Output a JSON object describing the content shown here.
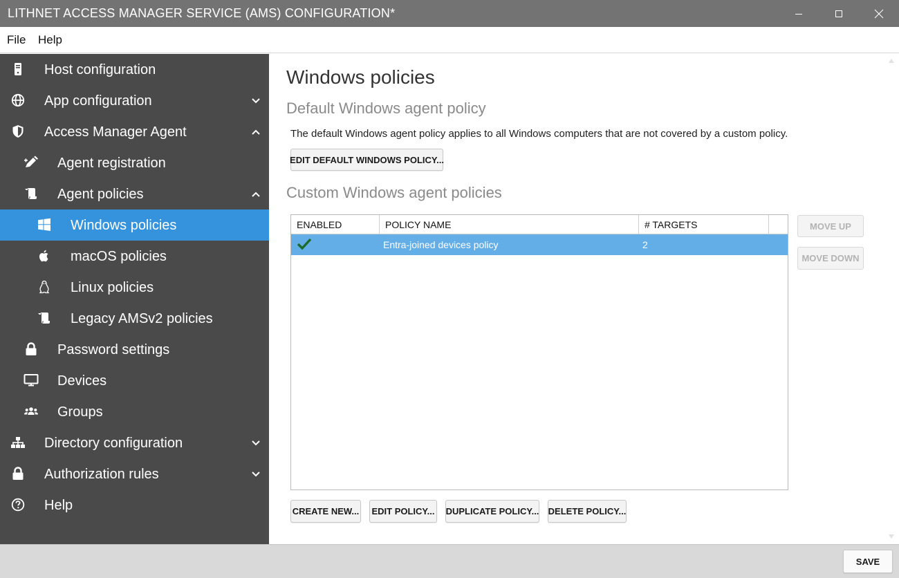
{
  "window": {
    "title": "LITHNET ACCESS MANAGER SERVICE (AMS) CONFIGURATION*",
    "minimize_icon": "minimize-icon",
    "maximize_icon": "maximize-icon",
    "close_icon": "close-icon"
  },
  "menu": {
    "file": "File",
    "help": "Help"
  },
  "sidebar": {
    "items": [
      {
        "label": "Host configuration",
        "icon": "server-icon"
      },
      {
        "label": "App configuration",
        "icon": "globe-icon",
        "chevron": "down"
      },
      {
        "label": "Access Manager Agent",
        "icon": "shield-icon",
        "chevron": "up"
      },
      {
        "label": "Agent registration",
        "icon": "pen-icon"
      },
      {
        "label": "Agent policies",
        "icon": "scroll-icon",
        "chevron": "up"
      },
      {
        "label": "Windows policies",
        "icon": "windows-icon",
        "selected": true
      },
      {
        "label": "macOS policies",
        "icon": "apple-icon"
      },
      {
        "label": "Linux policies",
        "icon": "linux-icon"
      },
      {
        "label": "Legacy AMSv2 policies",
        "icon": "scroll-icon"
      },
      {
        "label": "Password settings",
        "icon": "lock-icon"
      },
      {
        "label": "Devices",
        "icon": "monitor-icon"
      },
      {
        "label": "Groups",
        "icon": "users-icon"
      },
      {
        "label": "Directory configuration",
        "icon": "sitemap-icon",
        "chevron": "down"
      },
      {
        "label": "Authorization rules",
        "icon": "lock-icon",
        "chevron": "down"
      },
      {
        "label": "Help",
        "icon": "help-circle-icon"
      }
    ],
    "selected_color": "#3593dd"
  },
  "main": {
    "page_title": "Windows policies",
    "default_section": {
      "title": "Default Windows agent policy",
      "description": "The default Windows agent policy applies to all Windows computers that are not covered by a custom policy.",
      "edit_button": "EDIT DEFAULT WINDOWS POLICY..."
    },
    "custom_section": {
      "title": "Custom Windows agent policies",
      "columns": [
        "ENABLED",
        "POLICY NAME",
        "# TARGETS"
      ],
      "rows": [
        {
          "enabled_icon": "checkmark-icon",
          "name": "Entra-joined devices policy",
          "targets": "2",
          "selected": true
        }
      ],
      "move_up": "MOVE UP",
      "move_down": "MOVE DOWN",
      "create_new": "CREATE NEW...",
      "edit_policy": "EDIT POLICY...",
      "duplicate_policy": "DUPLICATE POLICY...",
      "delete_policy": "DELETE POLICY..."
    }
  },
  "footer": {
    "save": "SAVE"
  }
}
